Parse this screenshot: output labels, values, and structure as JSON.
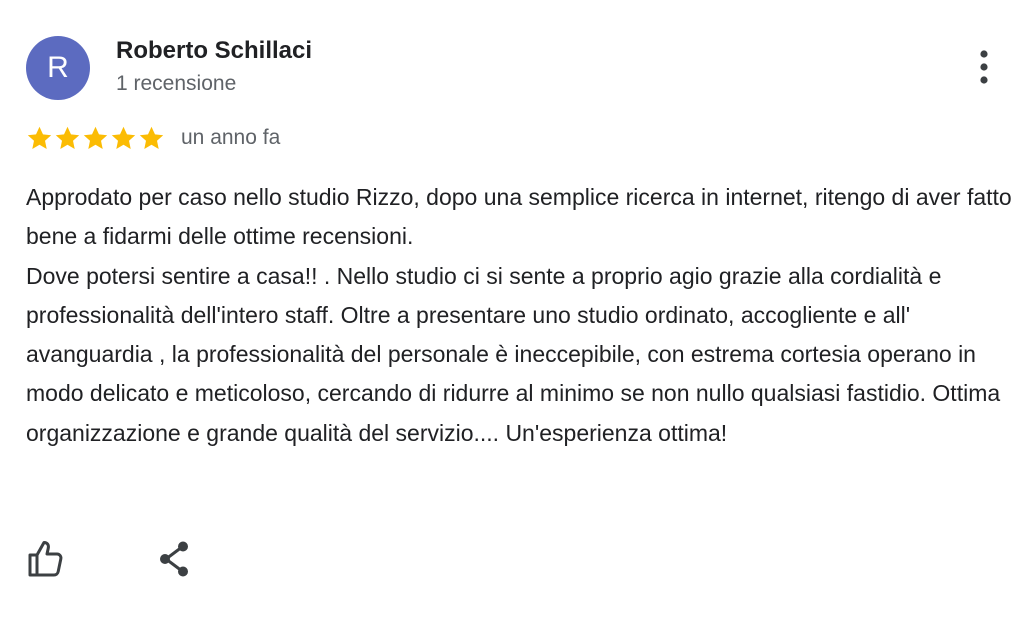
{
  "review": {
    "author": {
      "initial": "R",
      "name": "Roberto Schillaci",
      "review_count_text": "1 recensione",
      "avatar_color": "#5c6bc0"
    },
    "rating": 5,
    "rating_max": 5,
    "star_color": "#fbbc04",
    "date": "un anno fa",
    "body_paragraphs": [
      "Approdato per caso nello studio Rizzo, dopo una semplice ricerca in internet, ritengo di aver fatto bene a fidarmi delle ottime recensioni.",
      "Dove potersi sentire a casa!! . Nello studio ci si sente a proprio agio grazie alla cordialità e professionalità dell'intero staff. Oltre a presentare uno studio ordinato, accogliente e all' avanguardia , la professionalità del personale è ineccepibile, con estrema cortesia operano in modo delicato e meticoloso, cercando di ridurre al minimo se non nullo qualsiasi fastidio. Ottima organizzazione e grande qualità del servizio.... Un'esperienza ottima!"
    ]
  },
  "actions": {
    "menu_icon": "more-vert-icon",
    "like_icon": "thumbs-up-icon",
    "share_icon": "share-icon"
  }
}
